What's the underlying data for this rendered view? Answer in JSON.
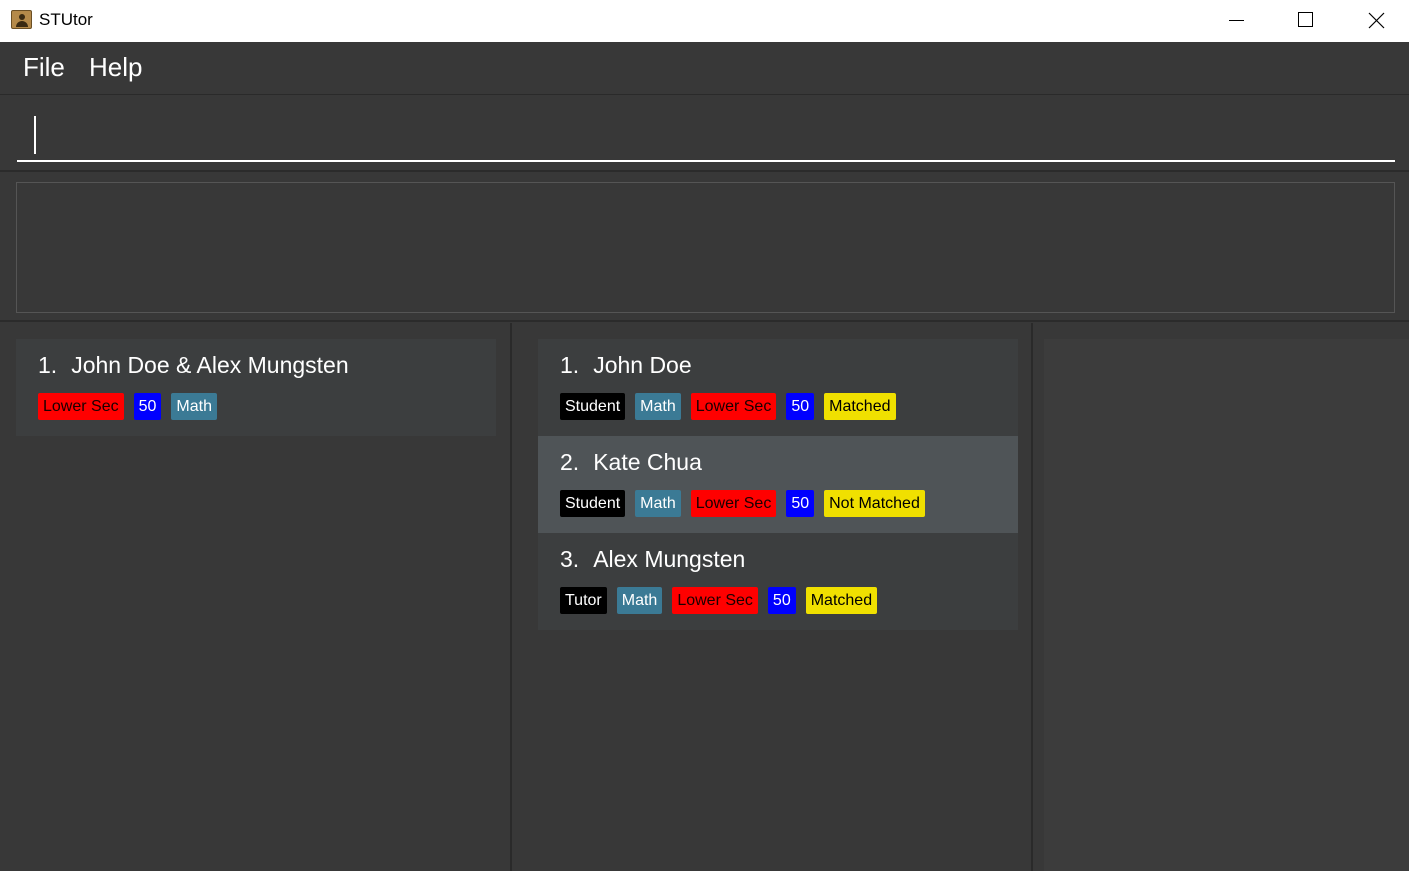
{
  "window": {
    "title": "STUtor"
  },
  "menu": {
    "file": "File",
    "help": "Help"
  },
  "command_box": {
    "value": ""
  },
  "result_display": {
    "text": ""
  },
  "colors": {
    "level": "#ff0000",
    "level_text": "#1a0000",
    "price": "#0000ff",
    "subject": "#3b7a95",
    "role": "#000000",
    "status": "#f0e000"
  },
  "matches": [
    {
      "index": "1.",
      "name": "John Doe & Alex Mungsten",
      "tags": [
        {
          "text": "Lower Sec",
          "kind": "level"
        },
        {
          "text": "50",
          "kind": "price"
        },
        {
          "text": "Math",
          "kind": "subject"
        }
      ]
    }
  ],
  "persons": [
    {
      "index": "1.",
      "name": "John Doe",
      "selected": false,
      "tags": [
        {
          "text": "Student",
          "kind": "role"
        },
        {
          "text": "Math",
          "kind": "subject"
        },
        {
          "text": "Lower Sec",
          "kind": "level"
        },
        {
          "text": "50",
          "kind": "price"
        },
        {
          "text": "Matched",
          "kind": "status"
        }
      ]
    },
    {
      "index": "2.",
      "name": "Kate Chua",
      "selected": true,
      "tags": [
        {
          "text": "Student",
          "kind": "role"
        },
        {
          "text": "Math",
          "kind": "subject"
        },
        {
          "text": "Lower Sec",
          "kind": "level"
        },
        {
          "text": "50",
          "kind": "price"
        },
        {
          "text": "Not Matched",
          "kind": "status"
        }
      ]
    },
    {
      "index": "3.",
      "name": "Alex Mungsten",
      "selected": false,
      "tags": [
        {
          "text": "Tutor",
          "kind": "role"
        },
        {
          "text": "Math",
          "kind": "subject"
        },
        {
          "text": "Lower Sec",
          "kind": "level"
        },
        {
          "text": "50",
          "kind": "price"
        },
        {
          "text": "Matched",
          "kind": "status"
        }
      ]
    }
  ]
}
